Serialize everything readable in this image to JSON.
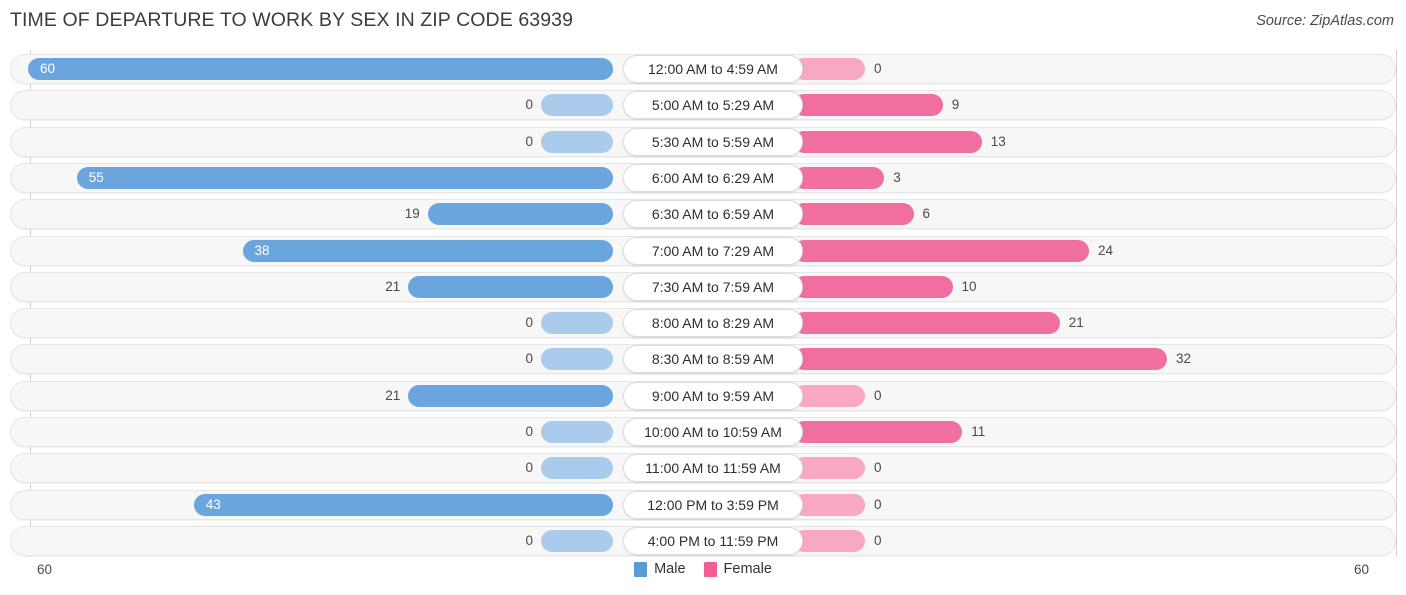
{
  "header": {
    "title": "TIME OF DEPARTURE TO WORK BY SEX IN ZIP CODE 63939",
    "source": "Source: ZipAtlas.com"
  },
  "legend": {
    "male_label": "Male",
    "female_label": "Female",
    "male_color": "#5b9bd5",
    "female_color": "#ef5f93"
  },
  "axis": {
    "left_max": "60",
    "right_max": "60"
  },
  "chart_data": {
    "type": "bar",
    "orientation": "horizontal-diverging",
    "title": "TIME OF DEPARTURE TO WORK BY SEX IN ZIP CODE 63939",
    "xlabel": "",
    "ylabel": "",
    "xlim": [
      60,
      60
    ],
    "grid": false,
    "legend_position": "bottom-center",
    "categories": [
      "12:00 AM to 4:59 AM",
      "5:00 AM to 5:29 AM",
      "5:30 AM to 5:59 AM",
      "6:00 AM to 6:29 AM",
      "6:30 AM to 6:59 AM",
      "7:00 AM to 7:29 AM",
      "7:30 AM to 7:59 AM",
      "8:00 AM to 8:29 AM",
      "8:30 AM to 8:59 AM",
      "9:00 AM to 9:59 AM",
      "10:00 AM to 10:59 AM",
      "11:00 AM to 11:59 AM",
      "12:00 PM to 3:59 PM",
      "4:00 PM to 11:59 PM"
    ],
    "series": [
      {
        "name": "Male",
        "values": [
          60,
          0,
          0,
          55,
          19,
          38,
          21,
          0,
          0,
          21,
          0,
          0,
          43,
          0
        ]
      },
      {
        "name": "Female",
        "values": [
          0,
          9,
          13,
          3,
          6,
          24,
          10,
          21,
          32,
          0,
          11,
          0,
          0,
          0
        ]
      }
    ]
  },
  "rows": [
    {
      "label": "12:00 AM to 4:59 AM",
      "male": "60",
      "female": "0"
    },
    {
      "label": "5:00 AM to 5:29 AM",
      "male": "0",
      "female": "9"
    },
    {
      "label": "5:30 AM to 5:59 AM",
      "male": "0",
      "female": "13"
    },
    {
      "label": "6:00 AM to 6:29 AM",
      "male": "55",
      "female": "3"
    },
    {
      "label": "6:30 AM to 6:59 AM",
      "male": "19",
      "female": "6"
    },
    {
      "label": "7:00 AM to 7:29 AM",
      "male": "38",
      "female": "24"
    },
    {
      "label": "7:30 AM to 7:59 AM",
      "male": "21",
      "female": "10"
    },
    {
      "label": "8:00 AM to 8:29 AM",
      "male": "0",
      "female": "21"
    },
    {
      "label": "8:30 AM to 8:59 AM",
      "male": "0",
      "female": "32"
    },
    {
      "label": "9:00 AM to 9:59 AM",
      "male": "21",
      "female": "0"
    },
    {
      "label": "10:00 AM to 10:59 AM",
      "male": "0",
      "female": "11"
    },
    {
      "label": "11:00 AM to 11:59 AM",
      "male": "0",
      "female": "0"
    },
    {
      "label": "12:00 PM to 3:59 PM",
      "male": "43",
      "female": "0"
    },
    {
      "label": "4:00 PM to 11:59 PM",
      "male": "0",
      "female": "0"
    }
  ]
}
